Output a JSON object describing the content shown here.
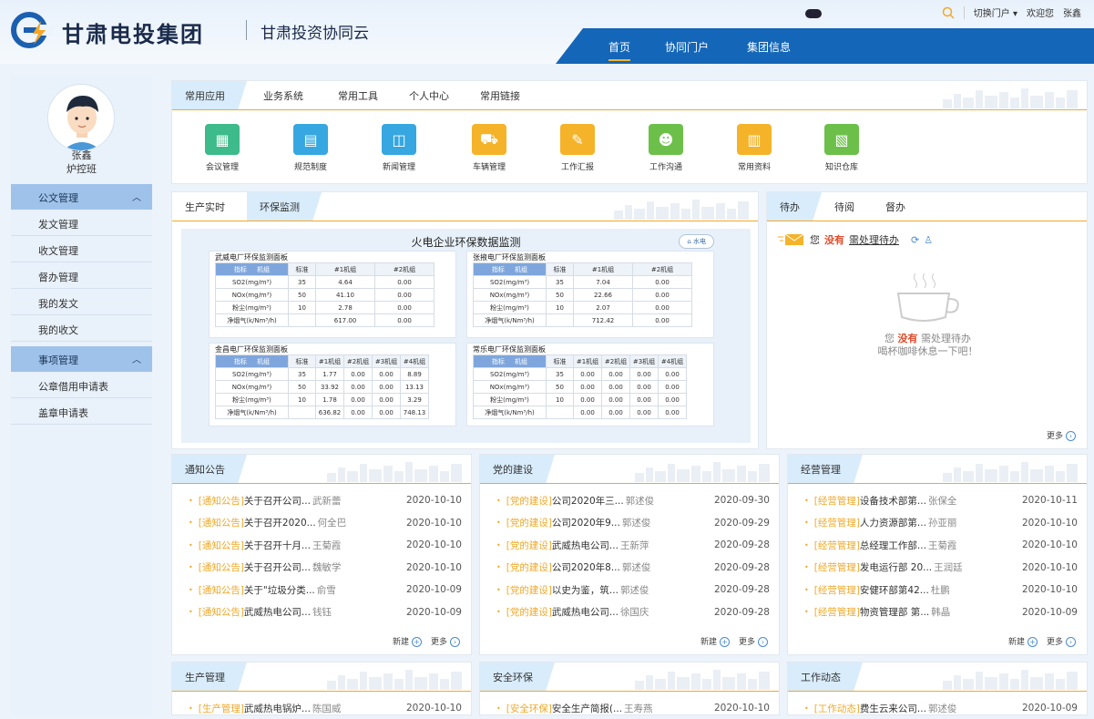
{
  "brand": {
    "name": "甘肃电投集团",
    "subtitle": "甘肃投资协同云"
  },
  "topbar": {
    "switch": "切换门户",
    "welcome": "欢迎您",
    "user": "张鑫"
  },
  "nav": [
    {
      "label": "首页",
      "active": true
    },
    {
      "label": "协同门户"
    },
    {
      "label": "集团信息"
    }
  ],
  "user": {
    "name": "张鑫",
    "dept": "炉控班"
  },
  "sidebar": {
    "groups": [
      {
        "label": "公文管理",
        "items": [
          "发文管理",
          "收文管理",
          "督办管理",
          "我的发文",
          "我的收文"
        ]
      },
      {
        "label": "事项管理",
        "items": [
          "公章借用申请表",
          "盖章申请表"
        ]
      }
    ]
  },
  "apps_panel": {
    "tabs": [
      "常用应用",
      "业务系统",
      "常用工具",
      "个人中心",
      "常用链接"
    ],
    "apps": [
      {
        "label": "会议管理",
        "color": "#3dbb8a",
        "icon": "meeting-icon"
      },
      {
        "label": "规范制度",
        "color": "#36a7e0",
        "icon": "rules-icon"
      },
      {
        "label": "新闻管理",
        "color": "#36a7e0",
        "icon": "news-icon"
      },
      {
        "label": "车辆管理",
        "color": "#f5b32a",
        "icon": "car-icon"
      },
      {
        "label": "工作汇报",
        "color": "#f5b32a",
        "icon": "report-icon"
      },
      {
        "label": "工作沟通",
        "color": "#6cc04a",
        "icon": "communicate-icon"
      },
      {
        "label": "常用资料",
        "color": "#f5b32a",
        "icon": "book-icon"
      },
      {
        "label": "知识仓库",
        "color": "#6cc04a",
        "icon": "knowledge-icon"
      }
    ]
  },
  "monitor": {
    "tabs": [
      "生产实时",
      "环保监测"
    ],
    "title": "火电企业环保数据监测",
    "button": "水电",
    "plants": [
      {
        "name": "武威电厂环保监测面板",
        "units": [
          "#1机组",
          "#2机组"
        ],
        "rows": [
          [
            "SO2(mg/m³)",
            "35",
            "4.64",
            "0.00"
          ],
          [
            "NOx(mg/m³)",
            "50",
            "41.10",
            "0.00"
          ],
          [
            "粉尘(mg/m³)",
            "10",
            "2.78",
            "0.00"
          ],
          [
            "净烟气(k/Nm³/h)",
            "",
            "617.00",
            "0.00"
          ]
        ]
      },
      {
        "name": "张掖电厂环保监测面板",
        "units": [
          "#1机组",
          "#2机组"
        ],
        "rows": [
          [
            "SO2(mg/m³)",
            "35",
            "7.04",
            "0.00"
          ],
          [
            "NOx(mg/m³)",
            "50",
            "22.66",
            "0.00"
          ],
          [
            "粉尘(mg/m³)",
            "10",
            "2.07",
            "0.00"
          ],
          [
            "净烟气(k/Nm³/h)",
            "",
            "712.42",
            "0.00"
          ]
        ]
      },
      {
        "name": "金昌电厂环保监测面板",
        "units": [
          "#1机组",
          "#2机组",
          "#3机组",
          "#4机组"
        ],
        "rows": [
          [
            "SO2(mg/m³)",
            "35",
            "1.77",
            "0.00",
            "0.00",
            "8.89"
          ],
          [
            "NOx(mg/m³)",
            "50",
            "33.92",
            "0.00",
            "0.00",
            "13.13"
          ],
          [
            "粉尘(mg/m³)",
            "10",
            "1.78",
            "0.00",
            "0.00",
            "3.29"
          ],
          [
            "净烟气(k/Nm³/h)",
            "",
            "636.82",
            "0.00",
            "0.00",
            "748.13"
          ]
        ]
      },
      {
        "name": "常乐电厂环保监测面板",
        "units": [
          "#1机组",
          "#2机组",
          "#3机组",
          "#4机组"
        ],
        "rows": [
          [
            "SO2(mg/m³)",
            "35",
            "0.00",
            "0.00",
            "0.00",
            "0.00"
          ],
          [
            "NOx(mg/m³)",
            "50",
            "0.00",
            "0.00",
            "0.00",
            "0.00"
          ],
          [
            "粉尘(mg/m³)",
            "10",
            "0.00",
            "0.00",
            "0.00",
            "0.00"
          ],
          [
            "净烟气(k/Nm³/h)",
            "",
            "0.00",
            "0.00",
            "0.00",
            "0.00"
          ]
        ]
      }
    ],
    "hdr_index": "指标",
    "hdr_unit": "机组",
    "hdr_std": "标准"
  },
  "todo": {
    "tabs": [
      "待办",
      "待阅",
      "督办"
    ],
    "line1_pre": "您",
    "line1_none": "没有",
    "line1_link": "需处理待办",
    "empty1_pre": "您",
    "empty1_none": "没有",
    "empty1_post": "需处理待办",
    "empty2": "喝杯咖啡休息一下吧！",
    "more": "更多"
  },
  "lists": [
    {
      "title": "通知公告",
      "items": [
        [
          "[通知公告]",
          "关于召开公司...",
          "武新蕾",
          "2020-10-10"
        ],
        [
          "[通知公告]",
          "关于召开2020...",
          "何全巴",
          "2020-10-10"
        ],
        [
          "[通知公告]",
          "关于召开十月...",
          "王菊霞",
          "2020-10-10"
        ],
        [
          "[通知公告]",
          "关于召开公司...",
          "魏敏学",
          "2020-10-10"
        ],
        [
          "[通知公告]",
          "关于\"垃圾分类...",
          "俞雪",
          "2020-10-09"
        ],
        [
          "[通知公告]",
          "武威热电公司...",
          "钱钰",
          "2020-10-09"
        ]
      ]
    },
    {
      "title": "党的建设",
      "items": [
        [
          "[党的建设]",
          "公司2020年三...",
          "郭述俊",
          "2020-09-30"
        ],
        [
          "[党的建设]",
          "公司2020年9...",
          "郭述俊",
          "2020-09-29"
        ],
        [
          "[党的建设]",
          "武威热电公司...",
          "王新萍",
          "2020-09-28"
        ],
        [
          "[党的建设]",
          "公司2020年8...",
          "郭述俊",
          "2020-09-28"
        ],
        [
          "[党的建设]",
          "以史为鉴，筑...",
          "郭述俊",
          "2020-09-28"
        ],
        [
          "[党的建设]",
          "武威热电公司...",
          "徐国庆",
          "2020-09-28"
        ]
      ]
    },
    {
      "title": "经营管理",
      "items": [
        [
          "[经营管理]",
          "设备技术部第...",
          "张保全",
          "2020-10-11"
        ],
        [
          "[经营管理]",
          "人力资源部第...",
          "孙亚丽",
          "2020-10-10"
        ],
        [
          "[经营管理]",
          "总经理工作部...",
          "王菊霞",
          "2020-10-10"
        ],
        [
          "[经营管理]",
          "发电运行部 20...",
          "王润廷",
          "2020-10-10"
        ],
        [
          "[经营管理]",
          "安健环部第42...",
          "杜鹏",
          "2020-10-10"
        ],
        [
          "[经营管理]",
          "物资管理部 第...",
          "韩晶",
          "2020-10-09"
        ]
      ]
    },
    {
      "title": "生产管理",
      "items": [
        [
          "[生产管理]",
          "武威热电锅炉...",
          "陈国威",
          "2020-10-10"
        ]
      ]
    },
    {
      "title": "安全环保",
      "items": [
        [
          "[安全环保]",
          "安全生产简报(...",
          "王寿燕",
          "2020-10-10"
        ]
      ]
    },
    {
      "title": "工作动态",
      "items": [
        [
          "[工作动态]",
          "费生云来公司...",
          "郭述俊",
          "2020-10-09"
        ]
      ]
    }
  ],
  "list_footer": {
    "new": "新建",
    "more": "更多"
  }
}
